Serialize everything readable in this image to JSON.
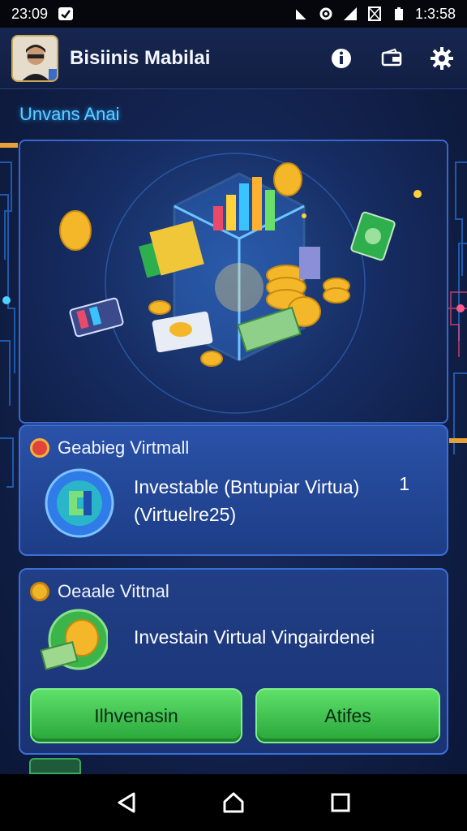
{
  "status_bar": {
    "time_left": "23:09",
    "time_right": "1:3:58",
    "icons": [
      "check-app-icon",
      "no-signal-icon",
      "gear-status-icon",
      "signal-icon",
      "sim-icon",
      "battery-icon"
    ]
  },
  "app_bar": {
    "title": "Bisiinis Mabilai",
    "actions": [
      "info-icon",
      "wallet-icon",
      "settings-icon"
    ]
  },
  "section_label": "Unvans Anai",
  "hero": {
    "illustration": "finance-cube-illustration"
  },
  "card1": {
    "title": "Geabieg Virtmall",
    "text_line1": "Investable (Bntupiar Virtua)",
    "text_line2": "(Virtuelre25)",
    "count": "1",
    "badge_color": "#e0443a",
    "icon": "exchange-icon"
  },
  "card2": {
    "title": "Oeaale Vittnal",
    "text": "Investain Virtual Vingairdenei",
    "badge_color": "#f0b429",
    "icon": "dollar-coin-icon",
    "button_left": "Ilhvenasin",
    "button_right": "Atifes"
  },
  "colors": {
    "accent": "#5fd0ff",
    "card_border": "#3b6fd6",
    "button_green": "#3cc04a"
  },
  "nav": [
    "back-icon",
    "home-icon",
    "recents-icon"
  ]
}
